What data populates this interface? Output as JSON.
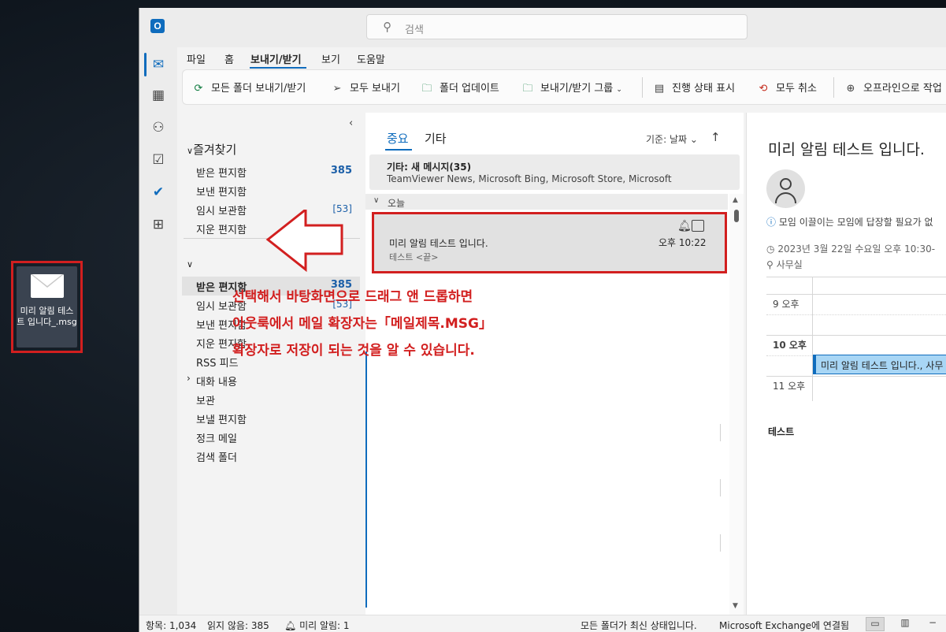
{
  "desktop": {
    "file_label": "미리 알림 테스트 입니다_.msg"
  },
  "titlebar": {
    "search_placeholder": "검색"
  },
  "menu": {
    "items": [
      "파일",
      "홈",
      "보내기/받기",
      "보기",
      "도움말"
    ],
    "active": "보내기/받기"
  },
  "ribbon": {
    "send_receive_all": "모든 폴더 보내기/받기",
    "send_all": "모두 보내기",
    "update_folder": "폴더 업데이트",
    "send_receive_groups": "보내기/받기 그룹",
    "show_progress": "진행 상태 표시",
    "cancel_all": "모두 취소",
    "work_offline": "오프라인으로 작업"
  },
  "folders": {
    "favorites_title": "즐겨찾기",
    "favorites": [
      {
        "label": "받은 편지함",
        "count": "385"
      },
      {
        "label": "보낸 편지함",
        "count": ""
      },
      {
        "label": "임시 보관함",
        "count": "[53]"
      },
      {
        "label": "지운 편지함",
        "count": ""
      }
    ],
    "account": [
      {
        "label": "받은 편지함",
        "count": "385"
      },
      {
        "label": "임시 보관함",
        "count": "[53]"
      },
      {
        "label": "보낸 편지함",
        "count": ""
      },
      {
        "label": "지운 편지함",
        "count": ""
      },
      {
        "label": "RSS 피드",
        "count": ""
      },
      {
        "label": "대화 내용",
        "count": ""
      },
      {
        "label": "보관",
        "count": ""
      },
      {
        "label": "보낼 편지함",
        "count": ""
      },
      {
        "label": "정크 메일",
        "count": ""
      },
      {
        "label": "검색 폴더",
        "count": ""
      }
    ]
  },
  "message_list": {
    "tab_focused": "중요",
    "tab_other": "기타",
    "sort_label": "기준: 날짜",
    "other_banner_title": "기타: 새 메시지(35)",
    "other_banner_senders": "TeamViewer News, Microsoft Bing, Microsoft Store, Microsoft",
    "group_today": "오늘",
    "message": {
      "subject": "미리 알림 테스트 입니다.",
      "preview": "테스트 <끝>",
      "time": "오후 10:22"
    }
  },
  "annotation": {
    "lines": [
      "선택해서 바탕화면으로 드래그 앤 드롭하면",
      "아웃룩에서 메일 확장자는「메일제목.MSG」",
      "확장자로 저장이 되는 것을 알 수 있습니다."
    ],
    "color": "#d21f1f"
  },
  "reading_pane": {
    "title": "미리 알림 테스트 입니다.",
    "info": "모임 이끌이는 모임에 답장할 필요가 없",
    "date": "2023년 3월 22일 수요일 오후 10:30-",
    "location": "사무실",
    "calendar_times": [
      "9 오후",
      "10 오후",
      "11 오후"
    ],
    "event_label": "미리 알림 테스트 입니다., 사무",
    "body": "테스트"
  },
  "statusbar": {
    "items": "항목: 1,034",
    "unread": "읽지 않음: 385",
    "reminders": "미리 알림: 1",
    "folder_status": "모든 폴더가 최신 상태입니다.",
    "connection": "Microsoft Exchange에 연결됨"
  },
  "colors": {
    "accent": "#0f6cbd",
    "highlight_red": "#d21f1f"
  }
}
